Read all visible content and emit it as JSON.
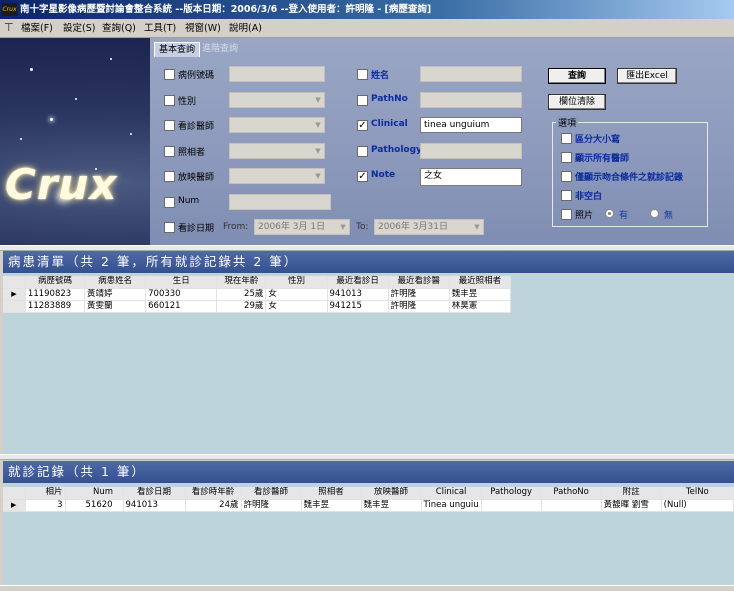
{
  "window": {
    "title": "南十字星影像病歷暨討論會整合系統 --版本日期：2006/3/6 --登入使用者：許明隆 - [病歷查詢]",
    "icon_text": "Crux"
  },
  "menu": [
    {
      "label": "檔案(F)"
    },
    {
      "label": "設定(S)"
    },
    {
      "label": "查詢(Q)"
    },
    {
      "label": "工具(T)"
    },
    {
      "label": "視窗(W)"
    },
    {
      "label": "說明(A)"
    }
  ],
  "logo": "Crux",
  "tabs": {
    "basic": "基本查詢",
    "advanced": "進階查詢"
  },
  "form": {
    "left": [
      {
        "label": "病例號碼",
        "value": ""
      },
      {
        "label": "性別",
        "value": ""
      },
      {
        "label": "看診醫師",
        "value": ""
      },
      {
        "label": "照相者",
        "value": ""
      },
      {
        "label": "放映醫師",
        "value": ""
      },
      {
        "label": "Num",
        "value": ""
      }
    ],
    "right": [
      {
        "label": "姓名",
        "value": "",
        "checked": false
      },
      {
        "label": "PathNo",
        "value": "",
        "checked": false
      },
      {
        "label": "Clinical",
        "value": "tinea unguium",
        "checked": true
      },
      {
        "label": "Pathology",
        "value": "",
        "checked": false
      },
      {
        "label": "Note",
        "value": "之女",
        "checked": true
      }
    ],
    "date": {
      "label": "看診日期",
      "from_label": "From:",
      "from_value": "2006年 3月 1日",
      "to_label": "To:",
      "to_value": "2006年 3月31日"
    }
  },
  "buttons": {
    "search": "查詢",
    "export": "匯出Excel",
    "clear": "欄位清除"
  },
  "options": {
    "title": "選項",
    "items": [
      {
        "label": "區分大小寫",
        "checked": false
      },
      {
        "label": "顯示所有醫師",
        "checked": false
      },
      {
        "label": "僅顯示吻合條件之就診記錄",
        "checked": false
      },
      {
        "label": "非空白",
        "checked": false
      }
    ],
    "photo": {
      "label": "照片",
      "yes": "有",
      "no": "無",
      "selected": "有"
    }
  },
  "patients": {
    "title": "病患清單（共 2 筆，所有就診記錄共 2 筆）",
    "columns": [
      "病歷號碼",
      "病患姓名",
      "生日",
      "現在年齡",
      "性別",
      "最近看診日",
      "最近看診醫",
      "最近照相者"
    ],
    "rows": [
      [
        "11190823",
        "黃靖婷",
        "700330",
        "25歲",
        "女",
        "941013",
        "許明隆",
        "魏丰昱"
      ],
      [
        "11283889",
        "黃雯蘭",
        "660121",
        "29歲",
        "女",
        "941215",
        "許明隆",
        "林昊憲"
      ]
    ]
  },
  "visits": {
    "title": "就診記錄（共 1 筆）",
    "columns": [
      "相片",
      "Num",
      "看診日期",
      "看診時年齡",
      "看診醫師",
      "照相者",
      "放映醫師",
      "Clinical",
      "Pathology",
      "PathoNo",
      "附註",
      "TelNo"
    ],
    "rows": [
      [
        "3",
        "51620",
        "941013",
        "24歲",
        "許明隆",
        "魏丰昱",
        "魏丰昱",
        "Tinea unguiu",
        "",
        "",
        "黃馥暉 劉雪",
        "(Null)"
      ]
    ]
  },
  "colors": {
    "title_bar": "#0a246a",
    "panel_header": "#3d5898",
    "grid_bg": "#bdd4da",
    "label_blue": "#0b2b9e"
  }
}
